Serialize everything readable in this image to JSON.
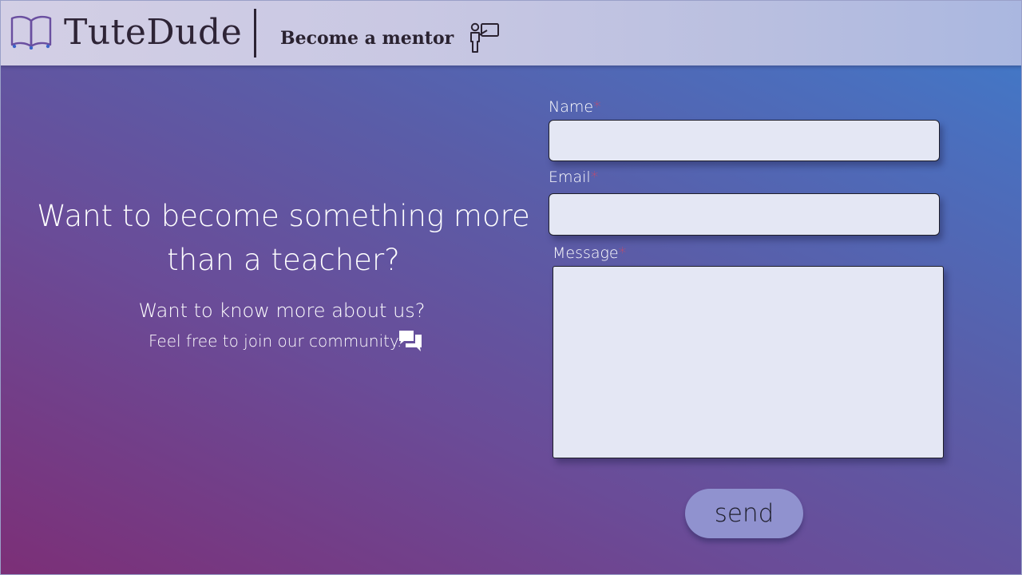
{
  "header": {
    "brand": "TuteDude",
    "mentor_link": "Become a mentor",
    "logo_icon": "open-book-icon",
    "mentor_icon": "teacher-board-icon"
  },
  "hero": {
    "title": "Want to become something more than a teacher?",
    "subtitle": "Want to know more about us?",
    "join_text": "Feel free to join our community.",
    "chat_icon": "chat-bubbles-icon"
  },
  "form": {
    "name_label": "Name",
    "email_label": "Email",
    "message_label": "Message",
    "required_mark": "*",
    "name_value": "",
    "email_value": "",
    "message_value": "",
    "send_label": "send"
  },
  "colors": {
    "header_bg": "#c9c8e3",
    "field_bg": "#e4e7f4",
    "button_bg": "#9092cf",
    "required": "#c74a6a",
    "gradient_start": "#7c2f77",
    "gradient_end": "#3e7ccb"
  }
}
